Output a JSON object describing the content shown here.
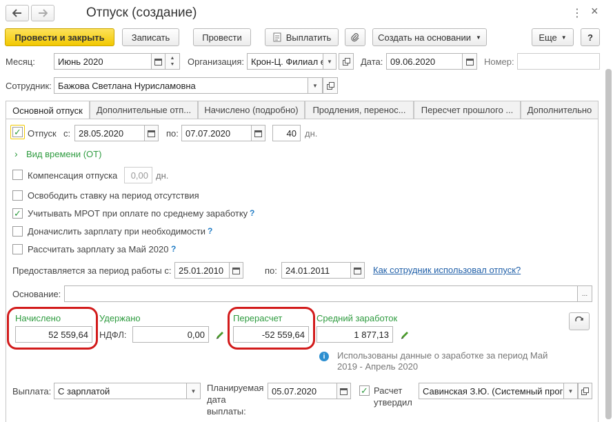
{
  "window": {
    "title": "Отпуск (создание)",
    "back_icon": "arrow-left",
    "forward_icon": "arrow-right",
    "more_icon": "vertical-ellipsis",
    "close_icon": "×"
  },
  "toolbar": {
    "post_close": "Провести и закрыть",
    "save": "Записать",
    "post": "Провести",
    "pay": "Выплатить",
    "attach_icon": "paperclip",
    "create_based": "Создать на основании",
    "more": "Еще",
    "help": "?"
  },
  "header": {
    "month_label": "Месяц:",
    "month_value": "Июнь 2020",
    "org_label": "Организация:",
    "org_value": "Крон-Ц. Филиал е",
    "date_label": "Дата:",
    "date_value": "09.06.2020",
    "number_label": "Номер:",
    "number_value": "",
    "employee_label": "Сотрудник:",
    "employee_value": "Бажова Светлана Нурисламовна"
  },
  "tabs": [
    {
      "label": "Основной отпуск"
    },
    {
      "label": "Дополнительные отп..."
    },
    {
      "label": "Начислено (подробно)"
    },
    {
      "label": "Продления, перенос..."
    },
    {
      "label": "Пересчет прошлого ..."
    },
    {
      "label": "Дополнительно"
    }
  ],
  "main": {
    "vacation_label": "Отпуск",
    "from_label": "с:",
    "from_value": "28.05.2020",
    "to_label": "по:",
    "to_value": "07.07.2020",
    "days_value": "40",
    "days_unit": "дн.",
    "time_type_link": "Вид времени (ОТ)",
    "compensation_label": "Компенсация отпуска",
    "compensation_value": "0,00",
    "compensation_unit": "дн.",
    "release_rate_label": "Освободить ставку на период отсутствия",
    "mrot_label": "Учитывать МРОТ при оплате по среднему заработку",
    "additional_salary_label": "Доначислить зарплату при необходимости",
    "calc_may_label": "Рассчитать зарплату за Май 2020",
    "period_label": "Предоставляется за период работы с:",
    "period_from": "25.01.2010",
    "period_to_label": "по:",
    "period_to": "24.01.2011",
    "usage_link": "Как сотрудник использовал отпуск?",
    "basis_label": "Основание:",
    "basis_value": "",
    "basis_btn": "...",
    "accrued_label": "Начислено",
    "accrued_value": "52 559,64",
    "withheld_label": "Удержано",
    "ndfl_label": "НДФЛ:",
    "ndfl_value": "0,00",
    "recalc_label": "Перерасчет",
    "recalc_value": "-52 559,64",
    "avg_label": "Средний заработок",
    "avg_value": "1 877,13",
    "info_text_1": "Использованы данные о заработке за период Май",
    "info_text_2": "2019 - Апрель 2020",
    "payment_label": "Выплата:",
    "payment_value": "С зарплатой",
    "planned_date_label_1": "Планируемая",
    "planned_date_label_2": "дата",
    "planned_date_label_3": "выплаты:",
    "planned_date_value": "05.07.2020",
    "approved_label_1": "Расчет",
    "approved_label_2": "утвердил",
    "approved_value": "Савинская З.Ю. (Системный прогр"
  },
  "colors": {
    "primary_button": "#f2c800",
    "highlight_red": "#d21b1b",
    "green_label": "#2e9b3f",
    "link_blue": "#1f5fa8"
  }
}
